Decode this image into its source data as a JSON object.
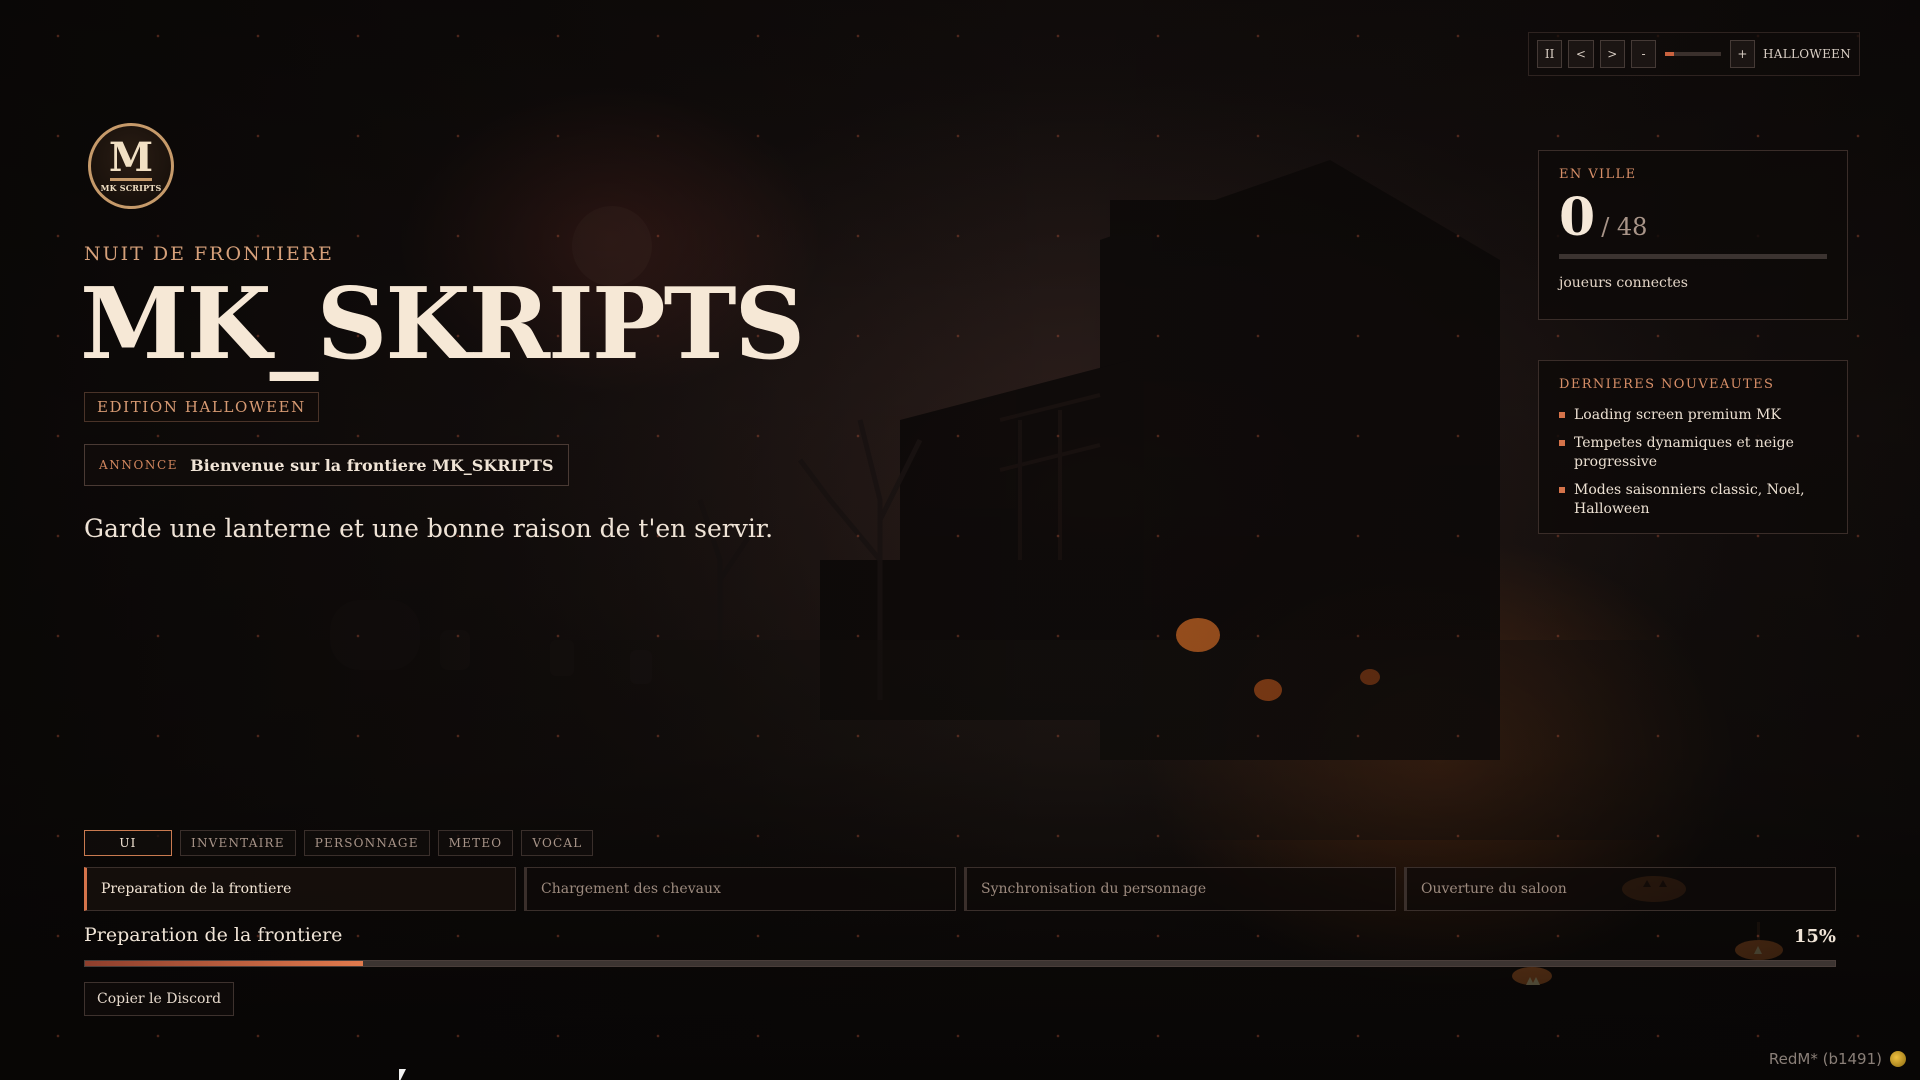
{
  "logo": {
    "letter": "M",
    "subtext": "MK SCRIPTS"
  },
  "hero": {
    "kicker": "NUIT DE FRONTIERE",
    "title": "MK_SKRIPTS",
    "edition": "EDITION HALLOWEEN",
    "annonce_tag": "ANNONCE",
    "annonce_text": "Bienvenue sur la frontiere MK_SKRIPTS",
    "tagline": "Garde une lanterne et une bonne raison de t'en servir."
  },
  "controls": {
    "pause_label": "II",
    "prev_label": "<",
    "next_label": ">",
    "minus_label": "-",
    "plus_label": "+",
    "volume_level": 0.15,
    "mode_label": "HALLOWEEN"
  },
  "players": {
    "label": "EN VILLE",
    "count": "0",
    "max": "/ 48",
    "fill_fraction": 0,
    "subtitle": "joueurs connectes"
  },
  "news": {
    "label": "DERNIERES NOUVEAUTES",
    "items": [
      "Loading screen premium MK",
      "Tempetes dynamiques et neige progressive",
      "Modes saisonniers classic, Noel, Halloween"
    ]
  },
  "tabs": [
    {
      "label": "UI",
      "active": true
    },
    {
      "label": "INVENTAIRE",
      "active": false
    },
    {
      "label": "PERSONNAGE",
      "active": false
    },
    {
      "label": "METEO",
      "active": false
    },
    {
      "label": "VOCAL",
      "active": false
    }
  ],
  "steps": [
    {
      "label": "Preparation de la frontiere",
      "active": true
    },
    {
      "label": "Chargement des chevaux",
      "active": false
    },
    {
      "label": "Synchronisation du personnage",
      "active": false
    },
    {
      "label": "Ouverture du saloon",
      "active": false
    }
  ],
  "progress": {
    "label": "Preparation de la frontiere",
    "percent_text": "15%",
    "value": 0.159
  },
  "discord_button": "Copier le Discord",
  "watermark": "RedM* (b1491)",
  "colors": {
    "accent": "#d5734a",
    "text": "#f0e4d6",
    "muted": "#9c8a7e"
  }
}
